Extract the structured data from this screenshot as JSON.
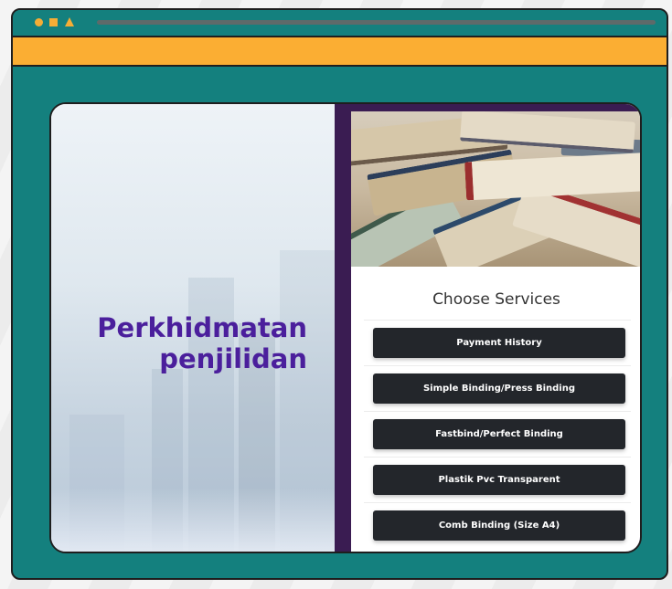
{
  "window": {
    "controls": [
      "circle-icon",
      "square-icon",
      "triangle-icon"
    ],
    "accent_color": "#fbae33",
    "frame_color": "#14807e"
  },
  "hero": {
    "line1": "Perkhidmatan",
    "line2": "penjilidan",
    "text_color": "#4b1f9c"
  },
  "services": {
    "title": "Choose Services",
    "buttons": [
      "Payment History",
      "Simple Binding/Press Binding",
      "Fastbind/Perfect Binding",
      "Plastik Pvc Transparent",
      "Comb Binding (Size A4)"
    ],
    "button_color": "#23262b",
    "panel_color": "#3a1c52"
  }
}
